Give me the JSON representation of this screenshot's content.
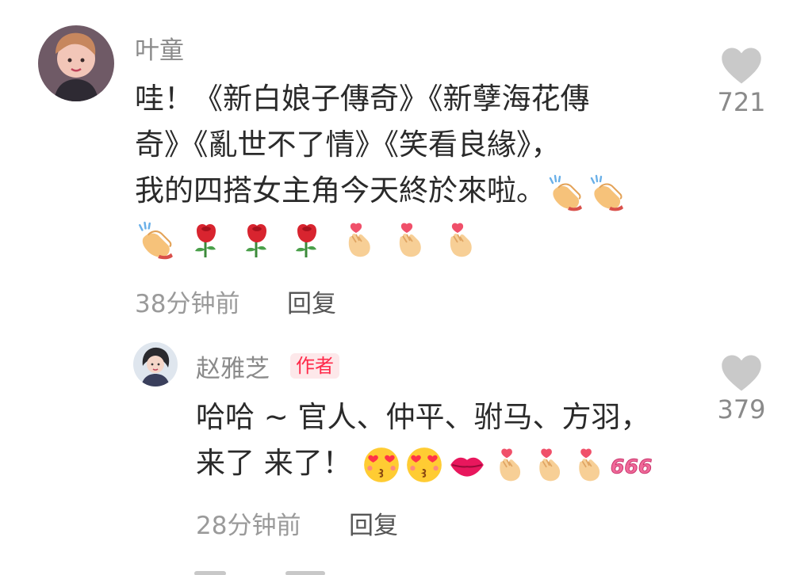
{
  "comments": [
    {
      "username": "叶童",
      "lines": [
        "哇！《新白娘子傳奇》《新孽海花傳",
        "奇》《亂世不了情》《笑看良緣》，",
        "我的四搭女主角今天終於來啦。"
      ],
      "emojis_line3": [
        "clap-icon",
        "clap-icon"
      ],
      "emojis_line4": [
        "clap-icon",
        "rose-icon",
        "rose-icon",
        "rose-icon",
        "finger-heart-icon",
        "finger-heart-icon",
        "finger-heart-icon"
      ],
      "time": "38分钟前",
      "reply_label": "回复",
      "likes": "721"
    },
    {
      "username": "赵雅芝",
      "badge": "作者",
      "lines": [
        "哈哈 ~ 官人、仲平、驸马、方羽，",
        "来了 来了！"
      ],
      "emojis_line2": [
        "heart-eyes-icon",
        "heart-eyes-icon",
        "lips-icon",
        "finger-heart-icon",
        "finger-heart-icon",
        "finger-heart-icon",
        "666-icon"
      ],
      "time": "28分钟前",
      "reply_label": "回复",
      "likes": "379"
    }
  ],
  "colors": {
    "badge_text": "#ff2a4a",
    "badge_bg": "#fde8ea",
    "like_icon": "#c9c9c9",
    "meta_text": "#9a9a9a"
  }
}
